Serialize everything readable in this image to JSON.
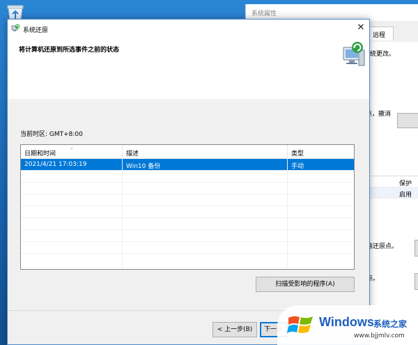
{
  "background_window": {
    "title": "系统属性",
    "tab_remote": "远程",
    "text_system_changes": "统更改。",
    "text_undo": "原点，撤消",
    "grid_header_protection": "保护",
    "grid_value_enabled": "启用",
    "text_delete_points": "删除还原点。",
    "text_restore_points": "原点。"
  },
  "dialog": {
    "title": "系统还原",
    "close_glyph": "✕",
    "heading": "将计算机还原到所选事件之前的状态",
    "timezone": "当前时区: GMT+8:00",
    "list": {
      "columns": [
        "日期和时间",
        "描述",
        "类型"
      ],
      "sort_glyph": "⌄",
      "rows": [
        {
          "date": "2021/4/21 17:03:19",
          "description": "Win10 备份",
          "type": "手动",
          "selected": true
        }
      ]
    },
    "scan_button": "扫描受影响的程序(A)",
    "back_button": "< 上一步(B)",
    "next_button": "下一步(N) >"
  },
  "watermark": {
    "windows": "Windows",
    "brand": "系统之家",
    "url": "www.bjjmlv.com"
  },
  "colors": {
    "selection": "#0078d7",
    "desktop": "#1a64b0",
    "dialog_border": "#4a87c9"
  }
}
